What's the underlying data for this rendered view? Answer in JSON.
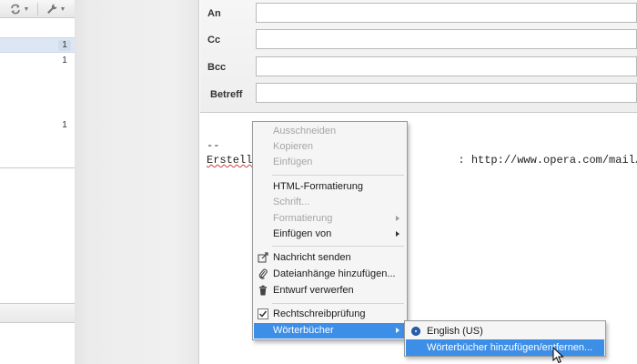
{
  "toolbar": {
    "sync_icon": "sync-icon",
    "tools_icon": "wrench-icon"
  },
  "folder_list": {
    "counts": [
      "1",
      "1",
      "1"
    ]
  },
  "compose": {
    "labels": {
      "to": "An",
      "cc": "Cc",
      "bcc": "Bcc",
      "subject": "Betreff"
    },
    "values": {
      "to": "",
      "cc": "",
      "bcc": "",
      "subject": ""
    },
    "body": {
      "dash": "--",
      "sig_prefix": "Erstell",
      "sig_suffix": ": http://www.opera.com/mail/"
    }
  },
  "context_menu": {
    "cut": "Ausschneiden",
    "copy": "Kopieren",
    "paste": "Einfügen",
    "html_format": "HTML-Formatierung",
    "font": "Schrift...",
    "formatting": "Formatierung",
    "insert_from": "Einfügen von",
    "send": "Nachricht senden",
    "attach": "Dateianhänge hinzufügen...",
    "discard": "Entwurf verwerfen",
    "spellcheck": "Rechtschreibprüfung",
    "dictionaries": "Wörterbücher"
  },
  "submenu": {
    "english": "English (US)",
    "manage": "Wörterbücher hinzufügen/entfernen..."
  },
  "colors": {
    "highlight": "#3d8ee6",
    "disabled_text": "#a6a6a6"
  }
}
